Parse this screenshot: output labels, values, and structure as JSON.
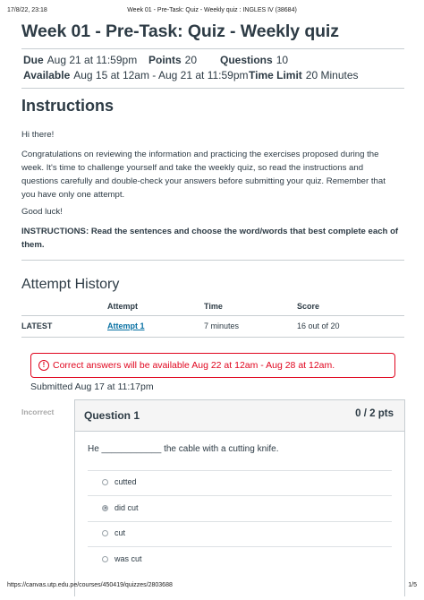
{
  "print_header": {
    "datetime": "17/8/22, 23:18",
    "page_title": "Week 01 - Pre-Task: Quiz - Weekly quiz : INGLES IV (38684)"
  },
  "print_footer": {
    "url": "https://canvas.utp.edu.pe/courses/450419/quizzes/2803688",
    "page_number": "1/5"
  },
  "quiz": {
    "title": "Week 01 - Pre-Task: Quiz - Weekly quiz",
    "due_label": "Due",
    "due_value": "Aug 21 at 11:59pm",
    "points_label": "Points",
    "points_value": "20",
    "questions_label": "Questions",
    "questions_value": "10",
    "available_label": "Available",
    "available_value": "Aug 15 at 12am - Aug 21 at 11:59pm",
    "time_limit_label": "Time Limit",
    "time_limit_value": "20 Minutes"
  },
  "instructions": {
    "heading": "Instructions",
    "greeting": "Hi there!",
    "body": "Congratulations on reviewing the information and practicing the exercises proposed during the week. It's time to challenge yourself and take the weekly quiz, so read the instructions and questions carefully and double-check your answers before submitting your quiz. Remember that you have only one attempt.",
    "good_luck": "Good luck!",
    "directive": "INSTRUCTIONS: Read the sentences and choose the word/words that best complete each of them."
  },
  "attempt_history": {
    "heading": "Attempt History",
    "columns": [
      "",
      "Attempt",
      "Time",
      "Score"
    ],
    "rows": [
      {
        "status": "LATEST",
        "attempt": "Attempt 1",
        "time": "7 minutes",
        "score": "16 out of 20"
      }
    ]
  },
  "banner": {
    "icon": "info-circle-icon",
    "text": "Correct answers will be available Aug 22 at 12am - Aug 28 at 12am."
  },
  "submitted": "Submitted Aug 17 at 11:17pm",
  "question1": {
    "result_label": "Incorrect",
    "name": "Question 1",
    "points": "0 / 2 pts",
    "text": "He ____________ the cable with a cutting knife.",
    "answers": [
      {
        "label": "cutted",
        "selected": false
      },
      {
        "label": "did cut",
        "selected": true
      },
      {
        "label": "cut",
        "selected": false
      },
      {
        "label": "was cut",
        "selected": false
      }
    ]
  },
  "colors": {
    "text": "#2d3b45",
    "link": "#0770a3",
    "alert": "#e0061f",
    "border": "#c7cdd1"
  }
}
